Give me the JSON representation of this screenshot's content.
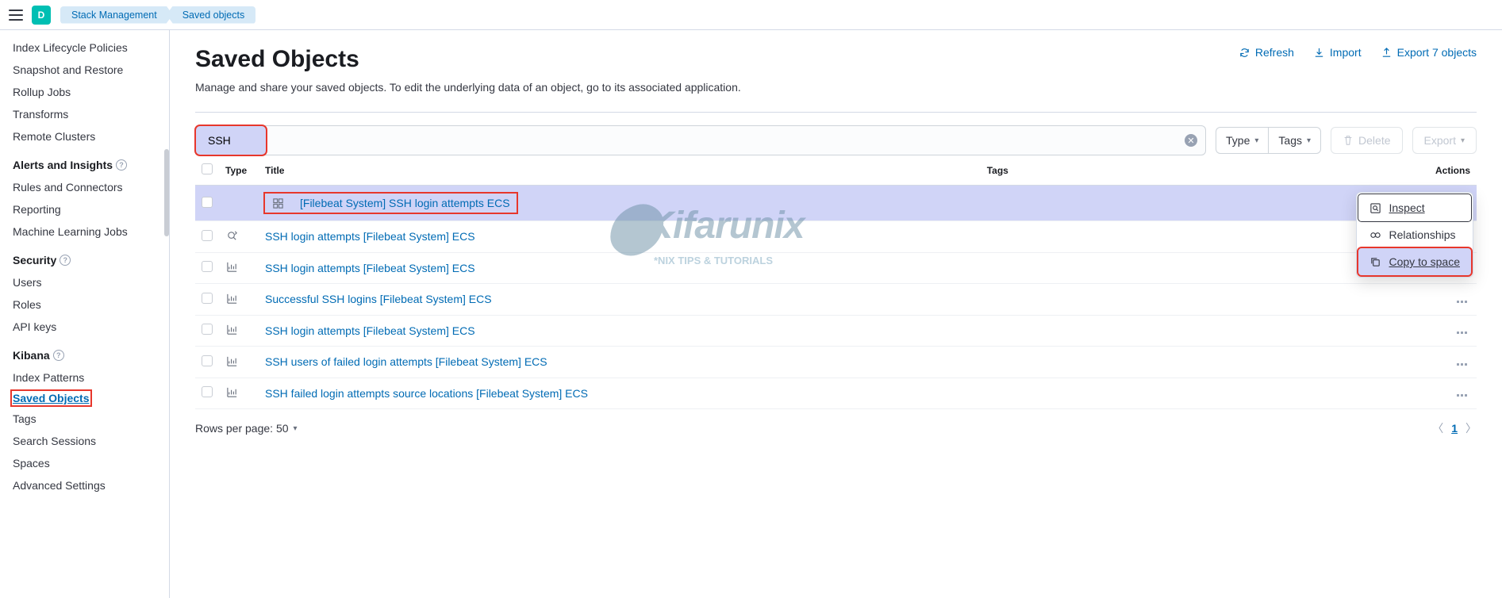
{
  "header": {
    "space_letter": "D",
    "breadcrumb": [
      "Stack Management",
      "Saved objects"
    ]
  },
  "sidebar": {
    "top_items": [
      "Index Lifecycle Policies",
      "Snapshot and Restore",
      "Rollup Jobs",
      "Transforms",
      "Remote Clusters"
    ],
    "sections": [
      {
        "heading": "Alerts and Insights",
        "items": [
          "Rules and Connectors",
          "Reporting",
          "Machine Learning Jobs"
        ]
      },
      {
        "heading": "Security",
        "items": [
          "Users",
          "Roles",
          "API keys"
        ]
      },
      {
        "heading": "Kibana",
        "items": [
          "Index Patterns",
          "Saved Objects",
          "Tags",
          "Search Sessions",
          "Spaces",
          "Advanced Settings"
        ],
        "active_index": 1
      }
    ]
  },
  "page": {
    "title": "Saved Objects",
    "description": "Manage and share your saved objects. To edit the underlying data of an object, go to its associated application.",
    "actions": {
      "refresh": "Refresh",
      "import": "Import",
      "export": "Export 7 objects"
    }
  },
  "toolbar": {
    "search_value": "SSH",
    "type_label": "Type",
    "tags_label": "Tags",
    "delete_label": "Delete",
    "export_label": "Export"
  },
  "table": {
    "columns": {
      "type": "Type",
      "title": "Title",
      "tags": "Tags",
      "actions": "Actions"
    },
    "rows": [
      {
        "icon": "dashboard",
        "title": "[Filebeat System] SSH login attempts ECS",
        "highlighted": true
      },
      {
        "icon": "search",
        "title": "SSH login attempts [Filebeat System] ECS"
      },
      {
        "icon": "viz",
        "title": "SSH login attempts [Filebeat System] ECS"
      },
      {
        "icon": "viz",
        "title": "Successful SSH logins [Filebeat System] ECS"
      },
      {
        "icon": "viz",
        "title": "SSH login attempts [Filebeat System] ECS"
      },
      {
        "icon": "viz",
        "title": "SSH users of failed login attempts [Filebeat System] ECS"
      },
      {
        "icon": "viz",
        "title": "SSH failed login attempts source locations [Filebeat System] ECS"
      }
    ]
  },
  "context_menu": {
    "inspect": "Inspect",
    "relationships": "Relationships",
    "copy_to_space": "Copy to space"
  },
  "footer": {
    "rows_label": "Rows per page: 50",
    "current_page": "1"
  },
  "watermark": {
    "logo": "Kifarunix",
    "sub": "*NIX TIPS & TUTORIALS"
  }
}
